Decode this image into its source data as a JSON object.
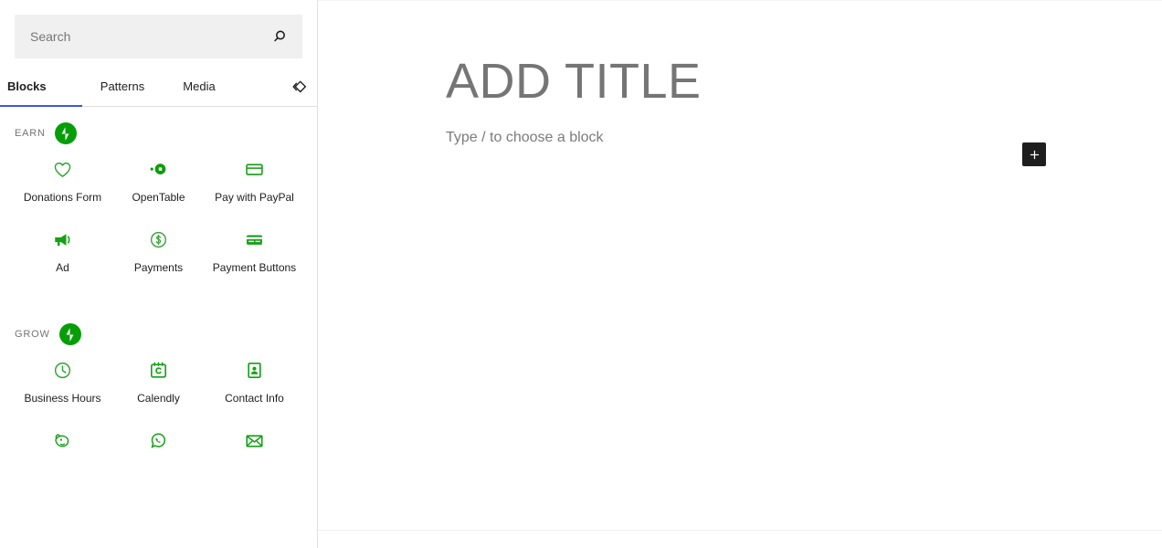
{
  "inserter": {
    "search": {
      "placeholder": "Search",
      "value": "",
      "icon": "search-icon"
    },
    "tabs": [
      {
        "id": "blocks",
        "label": "Blocks",
        "active": true
      },
      {
        "id": "patterns",
        "label": "Patterns",
        "active": false
      },
      {
        "id": "media",
        "label": "Media",
        "active": false
      }
    ],
    "tools": {
      "toggle_icon": "overlapping-diamonds-icon"
    },
    "active_tab_underline_color": "#3858e9",
    "brand_green": "#069e08",
    "categories": [
      {
        "id": "earn",
        "title": "EARN",
        "badge_icon": "jetpack-logo-icon",
        "blocks": [
          {
            "label": "Donations Form",
            "icon": "heart-outline-icon"
          },
          {
            "label": "OpenTable",
            "icon": "opentable-icon"
          },
          {
            "label": "Pay with PayPal",
            "icon": "credit-card-outline-icon"
          },
          {
            "label": "Ad",
            "icon": "megaphone-icon"
          },
          {
            "label": "Payments",
            "icon": "dollar-circle-icon"
          },
          {
            "label": "Payment Buttons",
            "icon": "credit-card-filled-icon"
          }
        ]
      },
      {
        "id": "grow",
        "title": "GROW",
        "badge_icon": "jetpack-logo-icon",
        "blocks": [
          {
            "label": "Business Hours",
            "icon": "clock-icon"
          },
          {
            "label": "Calendly",
            "icon": "calendly-calendar-icon"
          },
          {
            "label": "Contact Info",
            "icon": "contact-card-icon"
          },
          {
            "label": "",
            "icon": "mailchimp-icon"
          },
          {
            "label": "",
            "icon": "whatsapp-icon"
          },
          {
            "label": "",
            "icon": "envelope-icon"
          }
        ]
      }
    ]
  },
  "editor": {
    "title_placeholder": "ADD TITLE",
    "paragraph_placeholder": "Type / to choose a block",
    "appender": {
      "label": "+",
      "name": "add-block-button"
    }
  }
}
